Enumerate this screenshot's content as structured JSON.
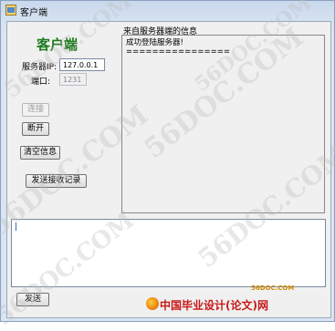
{
  "window": {
    "title": "客户端"
  },
  "left_panel": {
    "heading": "客户端",
    "server_ip_label": "服务器IP:",
    "server_ip_value": "127.0.0.1",
    "port_label": "端口:",
    "port_value": "1231",
    "connect_button": "连接",
    "disconnect_button": "断开",
    "clear_button": "清空信息",
    "send_receive_log_button": "发送接收记录"
  },
  "message_panel": {
    "label": "来自服务器端的信息",
    "lines": [
      "成功登陆服务器!",
      "================"
    ]
  },
  "send_button": "发送",
  "watermarks": [
    "56DOC.COM",
    "56DOC.COM",
    "56DOC.COM",
    "56DOC.COM",
    "56DOC.COM",
    "56DOC.COM"
  ],
  "footer": {
    "domain": "56DOC.COM",
    "brand_text": "中国毕业设计(论文)网"
  }
}
